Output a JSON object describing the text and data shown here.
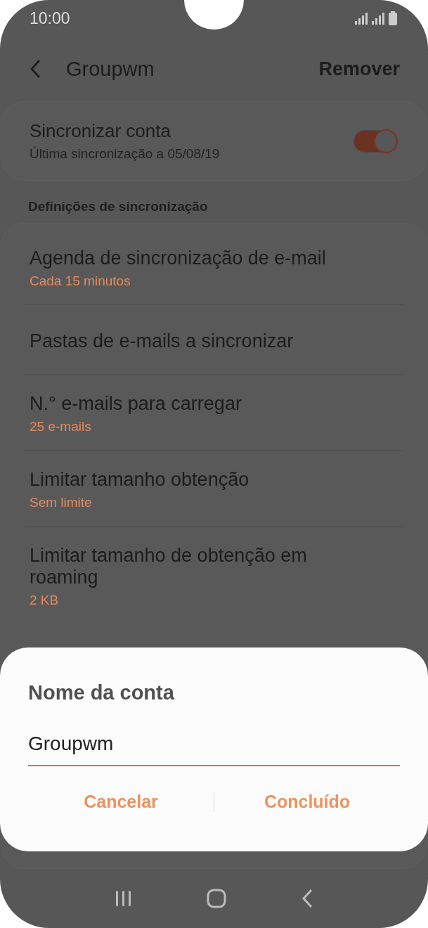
{
  "status_bar": {
    "time": "10:00"
  },
  "header": {
    "title": "Groupwm",
    "action": "Remover"
  },
  "sync": {
    "title": "Sincronizar conta",
    "subtitle": "Última sincronização a 05/08/19",
    "on": true
  },
  "section": "Definições de sincronização",
  "items": [
    {
      "title": "Agenda de sincronização de e-mail",
      "subtitle": "Cada 15 minutos"
    },
    {
      "title": "Pastas de e-mails a sincronizar"
    },
    {
      "title": "N.° e-mails para carregar",
      "subtitle": "25 e-mails"
    },
    {
      "title": "Limitar tamanho obtenção",
      "subtitle": "Sem limite"
    },
    {
      "title": "Limitar tamanho de obtenção em roaming",
      "subtitle": "2 KB"
    }
  ],
  "dialog": {
    "title": "Nome da conta",
    "value": "Groupwm",
    "buttons": [
      "Cancelar",
      "Concluído"
    ]
  }
}
